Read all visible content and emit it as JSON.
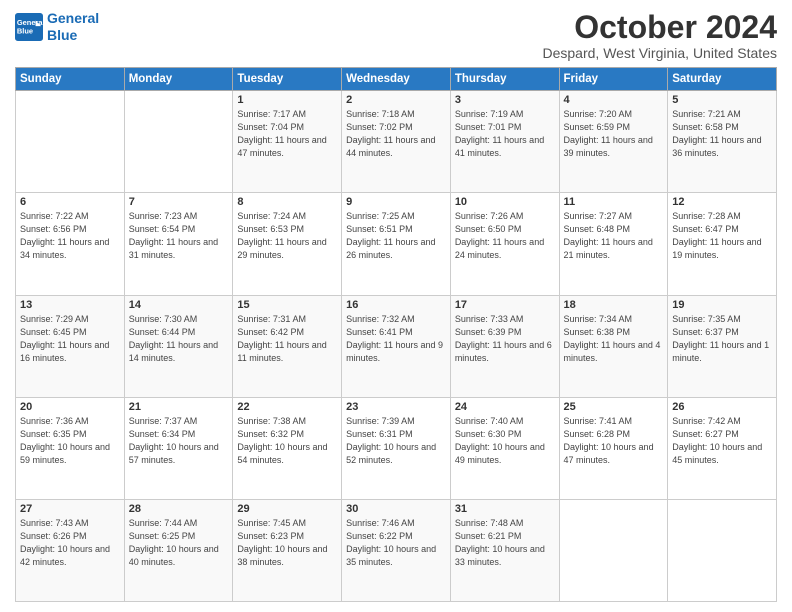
{
  "logo": {
    "line1": "General",
    "line2": "Blue"
  },
  "title": "October 2024",
  "subtitle": "Despard, West Virginia, United States",
  "days_of_week": [
    "Sunday",
    "Monday",
    "Tuesday",
    "Wednesday",
    "Thursday",
    "Friday",
    "Saturday"
  ],
  "weeks": [
    [
      {
        "day": "",
        "info": ""
      },
      {
        "day": "",
        "info": ""
      },
      {
        "day": "1",
        "info": "Sunrise: 7:17 AM\nSunset: 7:04 PM\nDaylight: 11 hours and 47 minutes."
      },
      {
        "day": "2",
        "info": "Sunrise: 7:18 AM\nSunset: 7:02 PM\nDaylight: 11 hours and 44 minutes."
      },
      {
        "day": "3",
        "info": "Sunrise: 7:19 AM\nSunset: 7:01 PM\nDaylight: 11 hours and 41 minutes."
      },
      {
        "day": "4",
        "info": "Sunrise: 7:20 AM\nSunset: 6:59 PM\nDaylight: 11 hours and 39 minutes."
      },
      {
        "day": "5",
        "info": "Sunrise: 7:21 AM\nSunset: 6:58 PM\nDaylight: 11 hours and 36 minutes."
      }
    ],
    [
      {
        "day": "6",
        "info": "Sunrise: 7:22 AM\nSunset: 6:56 PM\nDaylight: 11 hours and 34 minutes."
      },
      {
        "day": "7",
        "info": "Sunrise: 7:23 AM\nSunset: 6:54 PM\nDaylight: 11 hours and 31 minutes."
      },
      {
        "day": "8",
        "info": "Sunrise: 7:24 AM\nSunset: 6:53 PM\nDaylight: 11 hours and 29 minutes."
      },
      {
        "day": "9",
        "info": "Sunrise: 7:25 AM\nSunset: 6:51 PM\nDaylight: 11 hours and 26 minutes."
      },
      {
        "day": "10",
        "info": "Sunrise: 7:26 AM\nSunset: 6:50 PM\nDaylight: 11 hours and 24 minutes."
      },
      {
        "day": "11",
        "info": "Sunrise: 7:27 AM\nSunset: 6:48 PM\nDaylight: 11 hours and 21 minutes."
      },
      {
        "day": "12",
        "info": "Sunrise: 7:28 AM\nSunset: 6:47 PM\nDaylight: 11 hours and 19 minutes."
      }
    ],
    [
      {
        "day": "13",
        "info": "Sunrise: 7:29 AM\nSunset: 6:45 PM\nDaylight: 11 hours and 16 minutes."
      },
      {
        "day": "14",
        "info": "Sunrise: 7:30 AM\nSunset: 6:44 PM\nDaylight: 11 hours and 14 minutes."
      },
      {
        "day": "15",
        "info": "Sunrise: 7:31 AM\nSunset: 6:42 PM\nDaylight: 11 hours and 11 minutes."
      },
      {
        "day": "16",
        "info": "Sunrise: 7:32 AM\nSunset: 6:41 PM\nDaylight: 11 hours and 9 minutes."
      },
      {
        "day": "17",
        "info": "Sunrise: 7:33 AM\nSunset: 6:39 PM\nDaylight: 11 hours and 6 minutes."
      },
      {
        "day": "18",
        "info": "Sunrise: 7:34 AM\nSunset: 6:38 PM\nDaylight: 11 hours and 4 minutes."
      },
      {
        "day": "19",
        "info": "Sunrise: 7:35 AM\nSunset: 6:37 PM\nDaylight: 11 hours and 1 minute."
      }
    ],
    [
      {
        "day": "20",
        "info": "Sunrise: 7:36 AM\nSunset: 6:35 PM\nDaylight: 10 hours and 59 minutes."
      },
      {
        "day": "21",
        "info": "Sunrise: 7:37 AM\nSunset: 6:34 PM\nDaylight: 10 hours and 57 minutes."
      },
      {
        "day": "22",
        "info": "Sunrise: 7:38 AM\nSunset: 6:32 PM\nDaylight: 10 hours and 54 minutes."
      },
      {
        "day": "23",
        "info": "Sunrise: 7:39 AM\nSunset: 6:31 PM\nDaylight: 10 hours and 52 minutes."
      },
      {
        "day": "24",
        "info": "Sunrise: 7:40 AM\nSunset: 6:30 PM\nDaylight: 10 hours and 49 minutes."
      },
      {
        "day": "25",
        "info": "Sunrise: 7:41 AM\nSunset: 6:28 PM\nDaylight: 10 hours and 47 minutes."
      },
      {
        "day": "26",
        "info": "Sunrise: 7:42 AM\nSunset: 6:27 PM\nDaylight: 10 hours and 45 minutes."
      }
    ],
    [
      {
        "day": "27",
        "info": "Sunrise: 7:43 AM\nSunset: 6:26 PM\nDaylight: 10 hours and 42 minutes."
      },
      {
        "day": "28",
        "info": "Sunrise: 7:44 AM\nSunset: 6:25 PM\nDaylight: 10 hours and 40 minutes."
      },
      {
        "day": "29",
        "info": "Sunrise: 7:45 AM\nSunset: 6:23 PM\nDaylight: 10 hours and 38 minutes."
      },
      {
        "day": "30",
        "info": "Sunrise: 7:46 AM\nSunset: 6:22 PM\nDaylight: 10 hours and 35 minutes."
      },
      {
        "day": "31",
        "info": "Sunrise: 7:48 AM\nSunset: 6:21 PM\nDaylight: 10 hours and 33 minutes."
      },
      {
        "day": "",
        "info": ""
      },
      {
        "day": "",
        "info": ""
      }
    ]
  ]
}
